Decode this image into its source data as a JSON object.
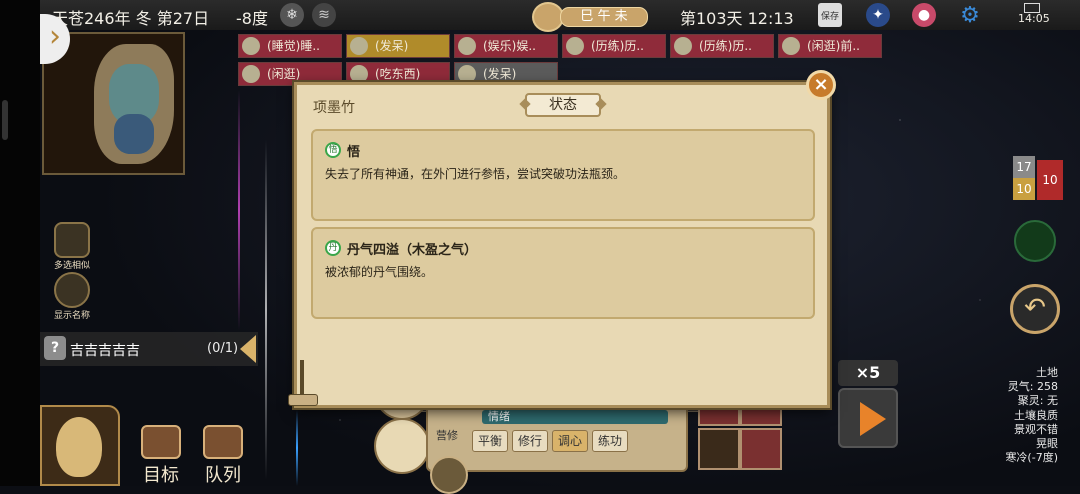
{
  "topbar": {
    "date": "天苍246年 冬 第27日",
    "temperature": "-8度",
    "shichen": "巳 午 未",
    "day_time": "第103天 12:13",
    "system_time": "14:05",
    "save_label": "保存"
  },
  "tags": [
    {
      "label": "(睡觉)睡..",
      "color": "red"
    },
    {
      "label": "(发呆)",
      "color": "gold"
    },
    {
      "label": "(娱乐)娱..",
      "color": "red"
    },
    {
      "label": "(历练)历..",
      "color": "red"
    },
    {
      "label": "(历练)历..",
      "color": "red"
    },
    {
      "label": "(闲逛)前..",
      "color": "red"
    },
    {
      "label": "(闲逛)",
      "color": "red"
    },
    {
      "label": "(吃东西)",
      "color": "red"
    },
    {
      "label": "(发呆)",
      "color": "gray"
    }
  ],
  "left_tools": {
    "multi_select": "多选相似",
    "show_names": "显示名称"
  },
  "quest": {
    "title": "吉吉吉吉吉",
    "count": "(0/1)"
  },
  "bottom_nav": {
    "target": "目标",
    "queue": "队列"
  },
  "right_chips": {
    "a": "17",
    "b": "10",
    "c": "10"
  },
  "speed": "×5",
  "tile_info": [
    "土地",
    "灵气: 258",
    "聚灵: 无",
    "土壤良质",
    "景观不错",
    "晃眼",
    "寒冷(-7度)"
  ],
  "background_panel": {
    "mood_label": "情绪",
    "attitude_label": "营修",
    "options": [
      "平衡",
      "修行",
      "调心",
      "练功"
    ],
    "selected_option": "调心"
  },
  "dialog": {
    "character_name": "项墨竹",
    "title": "状态",
    "statuses": [
      {
        "icon_char": "悟",
        "title": "悟",
        "description": "失去了所有神通，在外门进行参悟，尝试突破功法瓶颈。"
      },
      {
        "icon_char": "丹",
        "title": "丹气四溢（木盈之气）",
        "description": "被浓郁的丹气围绕。"
      }
    ]
  },
  "colors": {
    "dialog_bg": "#e8d9b4",
    "card_bg": "#ddcb9f",
    "tag_red": "#8f2b3a",
    "tag_gold": "#b08b2a",
    "accent_orange": "#e8832a"
  }
}
